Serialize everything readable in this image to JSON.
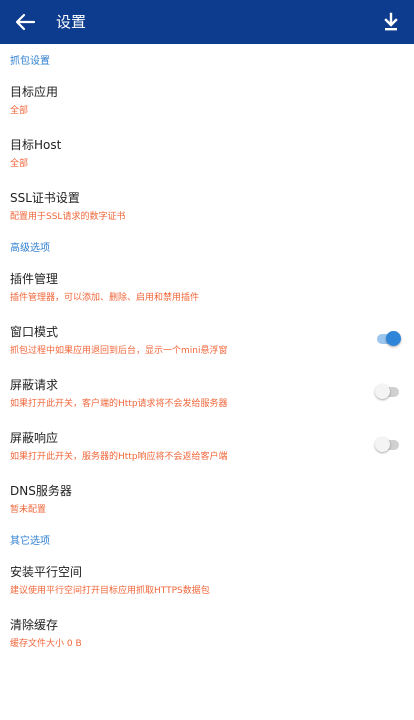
{
  "header": {
    "title": "设置"
  },
  "sections": [
    {
      "header": "抓包设置",
      "items": [
        {
          "label": "目标应用",
          "summary": "全部"
        },
        {
          "label": "目标Host",
          "summary": "全部"
        },
        {
          "label": "SSL证书设置",
          "summary": "配置用于SSL请求的数字证书"
        }
      ]
    },
    {
      "header": "高级选项",
      "items": [
        {
          "label": "插件管理",
          "summary": "插件管理器，可以添加、删除、启用和禁用插件"
        },
        {
          "label": "窗口模式",
          "summary": "抓包过程中如果应用退回到后台，显示一个mini悬浮窗",
          "switch": "on"
        },
        {
          "label": "屏蔽请求",
          "summary": "如果打开此开关，客户端的Http请求将不会发给服务器",
          "switch": "off"
        },
        {
          "label": "屏蔽响应",
          "summary": "如果打开此开关，服务器的Http响应将不会返给客户端",
          "switch": "off"
        },
        {
          "label": "DNS服务器",
          "summary": "暂未配置"
        }
      ]
    },
    {
      "header": "其它选项",
      "items": [
        {
          "label": "安装平行空间",
          "summary": "建议使用平行空间打开目标应用抓取HTTPS数据包"
        },
        {
          "label": "清除缓存",
          "summary": "缓存文件大小 0 B"
        }
      ]
    }
  ],
  "colors": {
    "appbar": "#0d3b8e",
    "section_header": "#2f7fcf",
    "summary": "#f0663a",
    "switch_on": "#2f86d8"
  },
  "icons": {
    "back": "arrow-back-icon",
    "download": "download-icon"
  }
}
